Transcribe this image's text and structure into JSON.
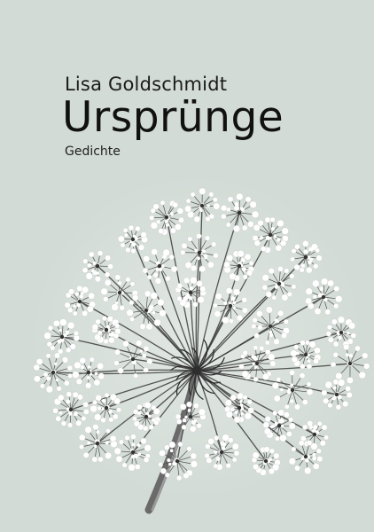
{
  "cover": {
    "author": "Lisa Goldschmidt",
    "title": "Ursprünge",
    "subtitle": "Gedichte"
  },
  "colors": {
    "background": "#d2dbd5",
    "text": "#111111",
    "flower_light": "#ffffff",
    "flower_dark": "#3a3a3a"
  },
  "illustration": {
    "subject": "wild-carrot-umbel"
  }
}
